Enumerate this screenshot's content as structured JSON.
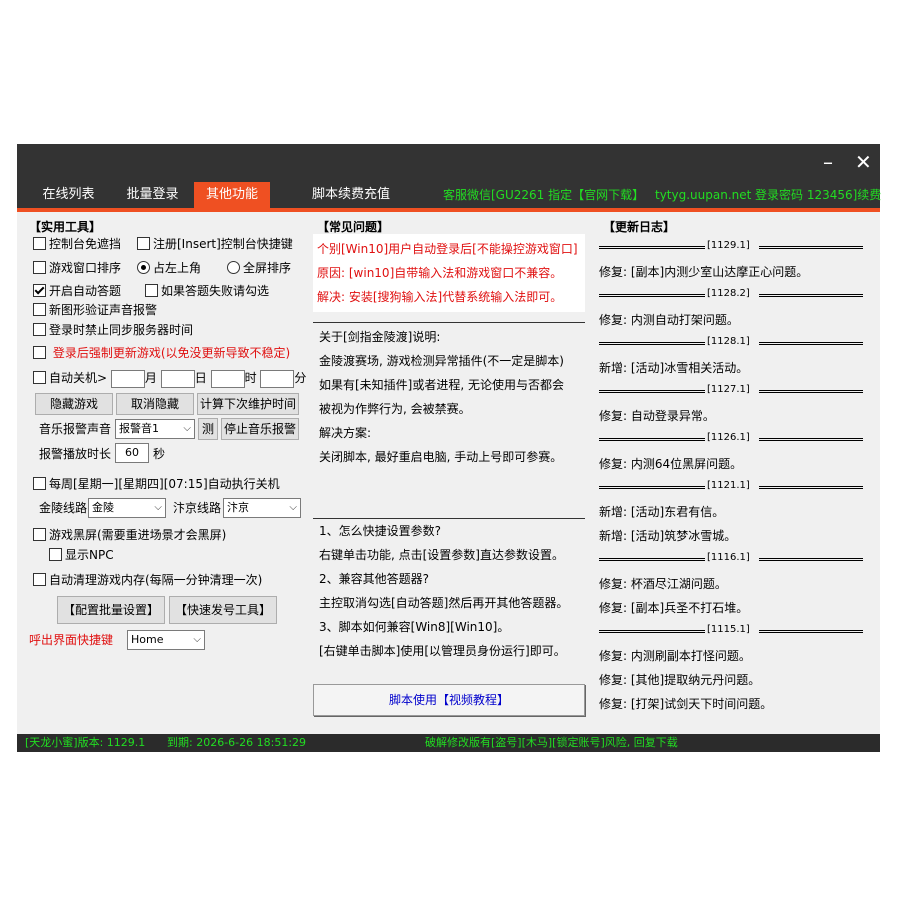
{
  "window": {
    "minimize_label": "–",
    "close_label": "✕"
  },
  "tabs": [
    "在线列表",
    "批量登录",
    "其他功能",
    "脚本续费充值"
  ],
  "top_info": {
    "service": "客服微信[GU2261 指定【官网下载】",
    "site": "tytyg.uupan.net",
    "login": "登录密码 123456]续费"
  },
  "tools": {
    "title": "【实用工具】",
    "console_no_block": "控制台免遮挡",
    "register_hotkey": "注册[Insert]控制台快捷键",
    "window_sort": "游戏窗口排序",
    "top_left": "占左上角",
    "full_sort": "全屏排序",
    "auto_answer": "开启自动答题",
    "answer_fail_hint": "如果答题失败请勾选",
    "captcha_sound": "新图形验证声音报警",
    "no_sync_time": "登录时禁止同步服务器时间",
    "force_update": "登录后强制更新游戏(以免没更新导致不稳定)",
    "auto_shutdown": "自动关机>",
    "month": "月",
    "day": "日",
    "hour": "时",
    "minute": "分",
    "hide_game": "隐藏游戏",
    "cancel_hide": "取消隐藏",
    "calc_maint": "计算下次维护时间",
    "alarm_sound_label": "音乐报警声音",
    "alarm_sound_value": "报警音1",
    "test_btn": "测",
    "stop_alarm": "停止音乐报警",
    "alarm_duration_label": "报警播放时长",
    "alarm_duration_value": "60",
    "seconds": "秒",
    "weekly_shutdown": "每周[星期一][星期四][07:15]自动执行关机",
    "jinling_label": "金陵线路",
    "jinling_value": "金陵",
    "bianjing_label": "汴京线路",
    "bianjing_value": "汴京",
    "black_screen": "游戏黑屏(需要重进场景才会黑屏)",
    "show_npc": "显示NPC",
    "auto_clean": "自动清理游戏内存(每隔一分钟清理一次)",
    "config_batch": "【配置批量设置】",
    "quick_tool": "【快速发号工具】",
    "hotkey_label": "呼出界面快捷键",
    "hotkey_value": "Home"
  },
  "faq": {
    "title": "【常见问题】",
    "notice": [
      "个别[Win10]用户自动登录后[不能操控游戏窗口]",
      "原因: [win10]自带输入法和游戏窗口不兼容。",
      "解决: 安装[搜狗输入法]代替系统输入法即可。"
    ],
    "section1": [
      "关于[剑指金陵渡]说明:",
      "金陵渡赛场, 游戏检测异常插件(不一定是脚本)",
      "如果有[未知插件]或者进程, 无论使用与否都会",
      "被视为作弊行为, 会被禁赛。",
      "解决方案:",
      "关闭脚本, 最好重启电脑, 手动上号即可参赛。"
    ],
    "section2": [
      "1、怎么快捷设置参数?",
      "右键单击功能, 点击[设置参数]直达参数设置。",
      "2、兼容其他答题器?",
      "主控取消勾选[自动答题]然后再开其他答题器。",
      "3、脚本如何兼容[Win8][Win10]。",
      "[右键单击脚本]使用[以管理员身份运行]即可。"
    ],
    "video_btn": "脚本使用【视频教程】"
  },
  "log": {
    "title": "【更新日志】",
    "entries": [
      {
        "sep": "[1129.1]"
      },
      {
        "line": "修复: [副本]内测少室山达摩正心问题。"
      },
      {
        "sep": "[1128.2]"
      },
      {
        "line": "修复: 内测自动打架问题。"
      },
      {
        "sep": "[1128.1]"
      },
      {
        "line": "新增: [活动]冰雪相关活动。"
      },
      {
        "sep": "[1127.1]"
      },
      {
        "line": "修复: 自动登录异常。"
      },
      {
        "sep": "[1126.1]"
      },
      {
        "line": "修复: 内测64位黑屏问题。"
      },
      {
        "sep": "[1121.1]"
      },
      {
        "line": "新增: [活动]东君有信。"
      },
      {
        "line": "新增: [活动]筑梦冰雪城。"
      },
      {
        "sep": "[1116.1]"
      },
      {
        "line": "修复: 杯酒尽江湖问题。"
      },
      {
        "line": "修复: [副本]兵圣不打石堆。"
      },
      {
        "sep": "[1115.1]"
      },
      {
        "line": "修复: 内测刷副本打怪问题。"
      },
      {
        "line": "修复: [其他]提取纳元丹问题。"
      },
      {
        "line": "修复: [打架]试剑天下时间问题。"
      }
    ]
  },
  "status": {
    "version": "[天龙小蜜]版本: 1129.1",
    "expiry": "到期: 2026-6-26 18:51:29",
    "right": "破解修改版有[盗号][木马][锁定账号]风险, 回复下载"
  },
  "colors": {
    "accent": "#ef5022",
    "green_text": "#22dd22",
    "red_text": "#e01010"
  }
}
